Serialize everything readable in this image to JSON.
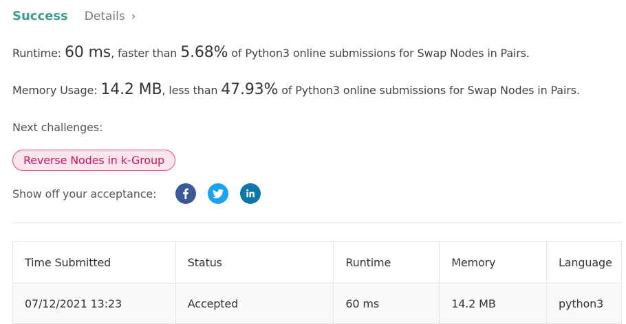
{
  "header": {
    "status": "Success",
    "details_link": "Details",
    "chevron": "›"
  },
  "runtime": {
    "label": "Runtime:",
    "value": "60 ms",
    "comparison": ", faster than",
    "percent": "5.68%",
    "suffix": "of Python3 online submissions for Swap Nodes in Pairs."
  },
  "memory": {
    "label": "Memory Usage:",
    "value": "14.2 MB",
    "comparison": ", less than",
    "percent": "47.93%",
    "suffix": "of Python3 online submissions for Swap Nodes in Pairs."
  },
  "next_challenges": {
    "label": "Next challenges:",
    "items": [
      "Reverse Nodes in k-Group"
    ]
  },
  "share": {
    "label": "Show off your acceptance:",
    "icons": [
      "facebook-icon",
      "twitter-icon",
      "linkedin-icon"
    ]
  },
  "submissions": {
    "headers": [
      "Time Submitted",
      "Status",
      "Runtime",
      "Memory",
      "Language"
    ],
    "rows": [
      [
        "07/12/2021 13:23",
        "Accepted",
        "60 ms",
        "14.2 MB",
        "python3"
      ]
    ]
  },
  "colors": {
    "success": "#3f9c8a",
    "tag_border": "#d44e82",
    "tag_bg": "#fbe4ec",
    "facebook": "#3b5998",
    "twitter": "#1da1f2",
    "linkedin": "#0e76a8"
  }
}
